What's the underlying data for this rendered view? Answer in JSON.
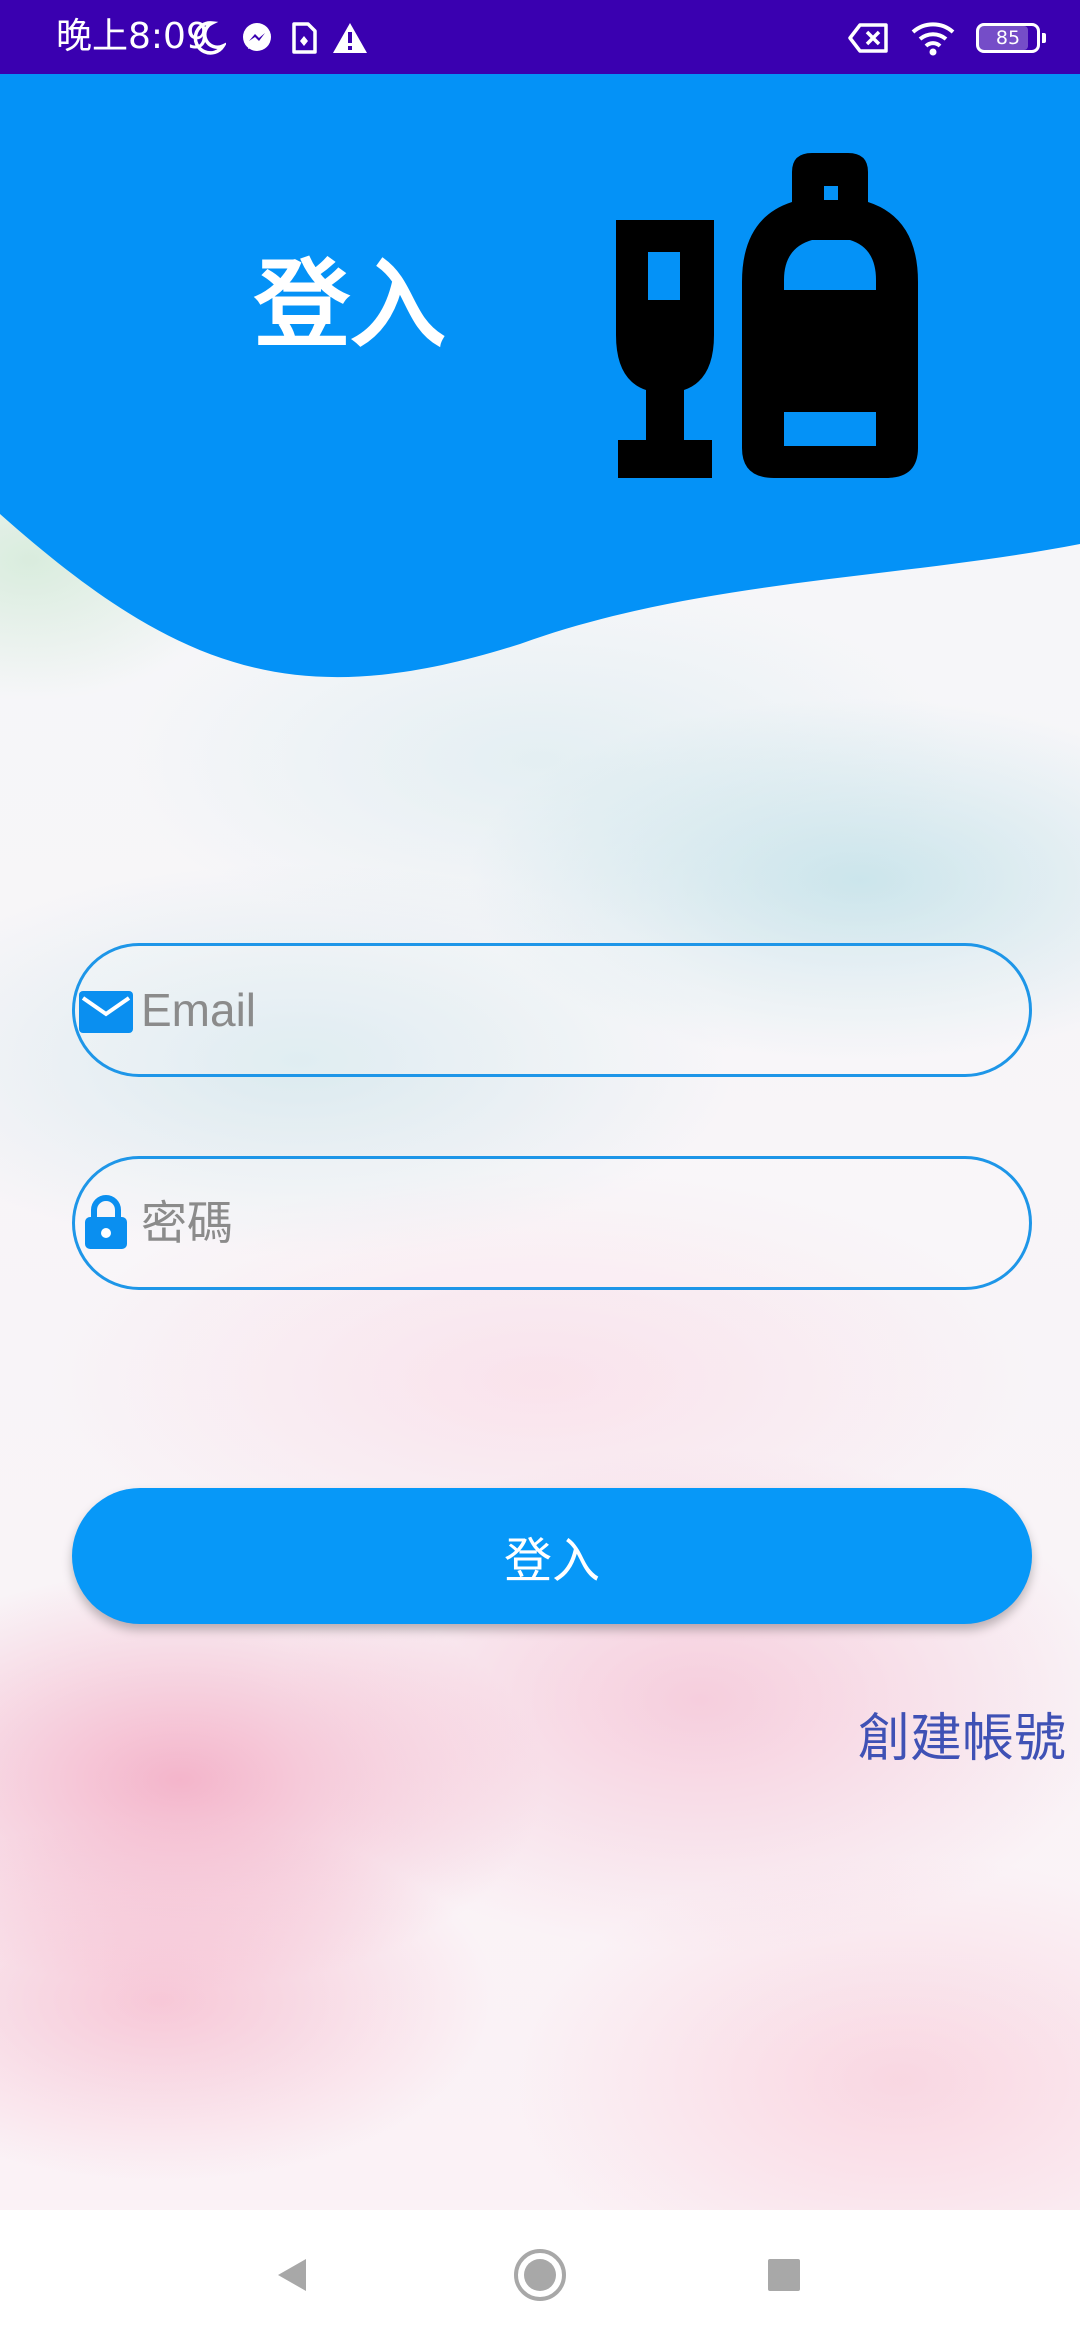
{
  "status_bar": {
    "time": "晚上8:09",
    "battery_level": "85",
    "icons_left": [
      "moon-icon",
      "messenger-icon",
      "sim-icon",
      "warning-icon"
    ],
    "icons_right": [
      "data-off-icon",
      "wifi-icon",
      "battery-icon"
    ]
  },
  "header": {
    "title": "登入",
    "icon": "wine-glass-bottle-icon"
  },
  "form": {
    "email": {
      "icon": "mail-icon",
      "placeholder": "Email",
      "value": ""
    },
    "password": {
      "icon": "lock-icon",
      "placeholder": "密碼",
      "value": ""
    }
  },
  "login_button": {
    "label": "登入"
  },
  "create_account": {
    "label": "創建帳號"
  },
  "nav_bar": {
    "icons": [
      "back-icon",
      "home-icon",
      "recent-apps-icon"
    ]
  },
  "colors": {
    "status_bar": "#3a00b0",
    "header": "#0492f7",
    "button": "#0798f8",
    "field_border": "#1e96e8",
    "link": "#3f51b5"
  }
}
